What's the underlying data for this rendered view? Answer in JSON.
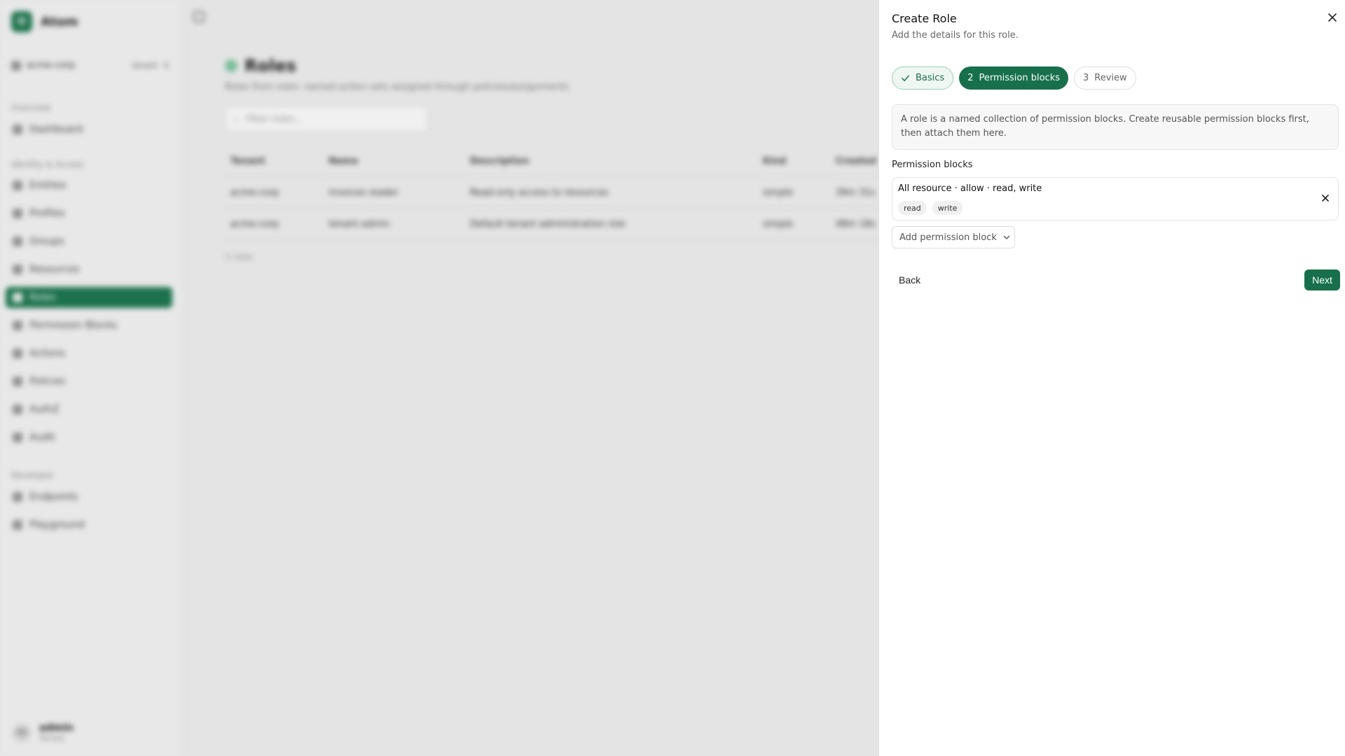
{
  "app": {
    "brand_initial": "O",
    "brand_name": "Atom",
    "tenant": "acme-corp",
    "tenant_badge": "tenant",
    "sections": {
      "overview": "Overview",
      "identity": "Identity & Access",
      "developer": "Developer"
    },
    "nav": {
      "dashboard": "Dashboard",
      "entities": "Entities",
      "profiles": "Profiles",
      "groups": "Groups",
      "resources": "Resources",
      "roles": "Roles",
      "permission_blocks": "Permission Blocks",
      "actions": "Actions",
      "policies": "Policies",
      "authz": "AuthZ",
      "audit": "Audit",
      "endpoints": "Endpoints",
      "playground": "Playground"
    },
    "user": {
      "initials": "AD",
      "name": "admin",
      "role": "Tenant"
    }
  },
  "page": {
    "title": "Roles",
    "subtitle": "Roles from roles: named action sets assigned through policies/assignments.",
    "filter_placeholder": "Filter roles...",
    "columns": [
      "Tenant",
      "Name",
      "Description",
      "Kind",
      "Created"
    ],
    "rows": [
      [
        "acme-corp",
        "invoices reader",
        "Read-only access to resources",
        "simple",
        "39m 31s"
      ],
      [
        "acme-corp",
        "tenant admin",
        "Default tenant administration role",
        "simple",
        "48m 18s"
      ]
    ],
    "rows_count": "2 roles"
  },
  "sheet": {
    "title": "Create Role",
    "subtitle": "Add the details for this role.",
    "steps": [
      {
        "number": "",
        "label": "Basics",
        "state": "done"
      },
      {
        "number": "2",
        "label": "Permission blocks",
        "state": "current"
      },
      {
        "number": "3",
        "label": "Review",
        "state": "upcoming"
      }
    ],
    "info": "A role is a named collection of permission blocks. Create reusable permission blocks first, then attach them here.",
    "blocks_label": "Permission blocks",
    "blocks": [
      {
        "title": "All resource · allow · read, write",
        "actions": [
          "read",
          "write"
        ]
      }
    ],
    "add_block_label": "Add permission block",
    "back_label": "Back",
    "next_label": "Next"
  },
  "colors": {
    "accent": "#17704b",
    "accent_soft": "#eef7f2",
    "border": "#e3e3e3"
  }
}
